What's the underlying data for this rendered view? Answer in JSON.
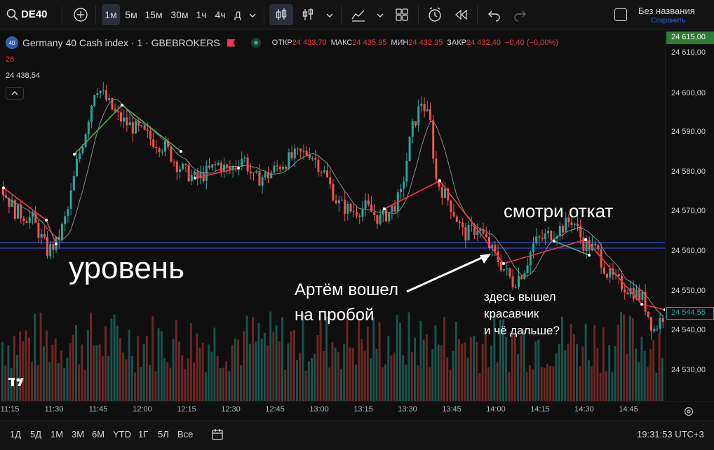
{
  "topbar": {
    "symbol": "DE40",
    "add_icon": "plus-circle-icon",
    "intervals": [
      "1м",
      "5м",
      "15м",
      "30м",
      "1ч",
      "4ч",
      "Д"
    ],
    "active_interval": "1м",
    "layout_name": "Без названия",
    "save_label": "Сохранить"
  },
  "legend": {
    "title": "Germany 40 Cash index · 1 · GBEBROKERS",
    "logo_text": "40",
    "open_label": "ОТКР",
    "open_value": "24 433,70",
    "high_label": "МАКС",
    "high_value": "24 435,95",
    "low_label": "МИН",
    "low_value": "24 432,35",
    "close_label": "ЗАКР",
    "close_value": "24 432,40",
    "change": "−0,40 (−0,00%)",
    "indicator_value": "26",
    "last_price": "24 438,54",
    "collapse_icon": "chevron-up-icon"
  },
  "price_axis": {
    "labels": [
      "24 610,00",
      "24 600,00",
      "24 590,00",
      "24 580,00",
      "24 570,00",
      "24 560,00",
      "24 550,00",
      "24 540,00",
      "24 530,00"
    ],
    "top_marker": "24 615,00",
    "current_marker": "24 544,55"
  },
  "time_axis": {
    "labels": [
      "11:15",
      "11:30",
      "11:45",
      "12:00",
      "12:15",
      "12:30",
      "12:45",
      "13:00",
      "13:15",
      "13:30",
      "13:45",
      "14:00",
      "14:15",
      "14:30",
      "14:45"
    ]
  },
  "annotations": {
    "level": "уровень",
    "entry": [
      "Артём вошел",
      "на пробой"
    ],
    "exit": [
      "здесь вышел",
      "красавчик",
      "и чё дальше?"
    ],
    "pullback": "смотри откат"
  },
  "bottombar": {
    "ranges": [
      "1Д",
      "5Д",
      "1М",
      "3М",
      "6М",
      "YTD",
      "1Г",
      "5Л",
      "Все"
    ],
    "clock": "19:31:53 UTC+3"
  },
  "colors": {
    "bg": "#0f0f0f",
    "up": "#26a69a",
    "down": "#ef5350",
    "level": "#2962ff",
    "zigzag_down": "#f23645",
    "zigzag_up": "#4caf50",
    "green_marker": "#1e6b3a",
    "text": "#d1d4dc"
  }
}
